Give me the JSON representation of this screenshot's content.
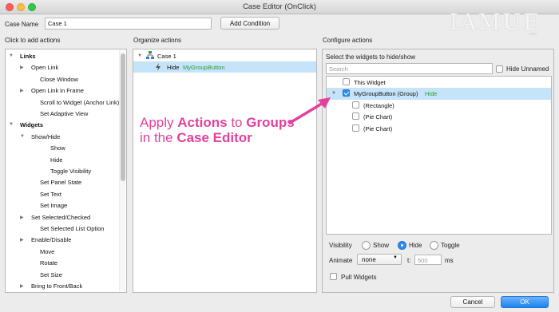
{
  "window": {
    "title": "Case Editor (OnClick)"
  },
  "watermark": {
    "text": "IAMUE",
    "sub": ".com"
  },
  "header": {
    "case_name_label": "Case Name",
    "case_name_value": "Case 1",
    "add_condition_label": "Add Condition"
  },
  "left": {
    "title": "Click to add actions",
    "items": [
      {
        "label": "Links",
        "tri": "▼"
      },
      {
        "label": "Open Link",
        "tri": "▶"
      },
      {
        "label": "Close Window",
        "tri": ""
      },
      {
        "label": "Open Link in Frame",
        "tri": "▶"
      },
      {
        "label": "Scroll to Widget (Anchor Link)",
        "tri": ""
      },
      {
        "label": "Set Adaptive View",
        "tri": ""
      },
      {
        "label": "Widgets",
        "tri": "▼"
      },
      {
        "label": "Show/Hide",
        "tri": "▼"
      },
      {
        "label": "Show",
        "tri": ""
      },
      {
        "label": "Hide",
        "tri": ""
      },
      {
        "label": "Toggle Visibility",
        "tri": ""
      },
      {
        "label": "Set Panel State",
        "tri": ""
      },
      {
        "label": "Set Text",
        "tri": ""
      },
      {
        "label": "Set Image",
        "tri": ""
      },
      {
        "label": "Set Selected/Checked",
        "tri": "▶"
      },
      {
        "label": "Set Selected List Option",
        "tri": ""
      },
      {
        "label": "Enable/Disable",
        "tri": "▶"
      },
      {
        "label": "Move",
        "tri": ""
      },
      {
        "label": "Rotate",
        "tri": ""
      },
      {
        "label": "Set Size",
        "tri": ""
      },
      {
        "label": "Bring to Front/Back",
        "tri": "▶"
      }
    ]
  },
  "middle": {
    "title": "Organize actions",
    "case_label": "Case 1",
    "action_verb": "Hide",
    "action_target": "MyGroupButton"
  },
  "right": {
    "title": "Configure actions",
    "subtitle": "Select the widgets to hide/show",
    "search_placeholder": "Search",
    "hide_unnamed_label": "Hide Unnamed",
    "widgets": [
      {
        "label": "This Widget",
        "checked": false,
        "status": ""
      },
      {
        "label": "MyGroupButton (Group)",
        "checked": true,
        "status": "Hide"
      },
      {
        "label": "(Rectangle)",
        "checked": false,
        "status": ""
      },
      {
        "label": "(Pie Chart)",
        "checked": false,
        "status": ""
      },
      {
        "label": "(Pie Chart)",
        "checked": false,
        "status": ""
      }
    ],
    "visibility_label": "Visibility",
    "visibility_options": [
      "Show",
      "Hide",
      "Toggle"
    ],
    "visibility_selected": "Hide",
    "animate_label": "Animate",
    "animate_value": "none",
    "t_label": "t:",
    "t_value": "500",
    "ms_label": "ms",
    "pull_widgets_label": "Pull Widgets"
  },
  "footer": {
    "cancel_label": "Cancel",
    "ok_label": "OK"
  },
  "annotation": {
    "line1_a": "Apply ",
    "line1_b": "Actions",
    "line1_c": " to ",
    "line1_d": "Groups",
    "line2_a": "in the ",
    "line2_b": "Case Editor"
  },
  "colors": {
    "accent": "#2d8cf0",
    "selection": "#c5e3f9",
    "annotation": "#e3409d",
    "status_green": "#2e9d33"
  }
}
